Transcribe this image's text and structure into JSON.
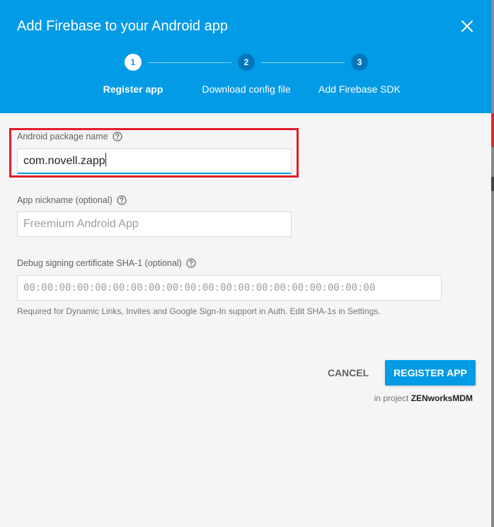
{
  "dialog": {
    "title": "Add Firebase to your Android app"
  },
  "stepper": {
    "steps": [
      {
        "number": "1",
        "label": "Register app",
        "state": "active"
      },
      {
        "number": "2",
        "label": "Download config file",
        "state": "inactive"
      },
      {
        "number": "3",
        "label": "Add Firebase SDK",
        "state": "inactive"
      }
    ]
  },
  "form": {
    "package_name": {
      "label": "Android package name",
      "value": "com.novell.zapp"
    },
    "nickname": {
      "label": "App nickname (optional)",
      "placeholder": "Freemium Android App"
    },
    "sha1": {
      "label": "Debug signing certificate SHA-1 (optional)",
      "placeholder": "00:00:00:00:00:00:00:00:00:00:00:00:00:00:00:00:00:00:00:00",
      "hint": "Required for Dynamic Links, Invites and Google Sign-In support in Auth. Edit SHA-1s in Settings."
    }
  },
  "actions": {
    "cancel_label": "CANCEL",
    "register_label": "REGISTER APP",
    "project_prefix": "in project",
    "project_name": "ZENworksMDM"
  },
  "colors": {
    "header": "#039be5",
    "highlight": "#e01e2c",
    "primary_button": "#039be5"
  }
}
